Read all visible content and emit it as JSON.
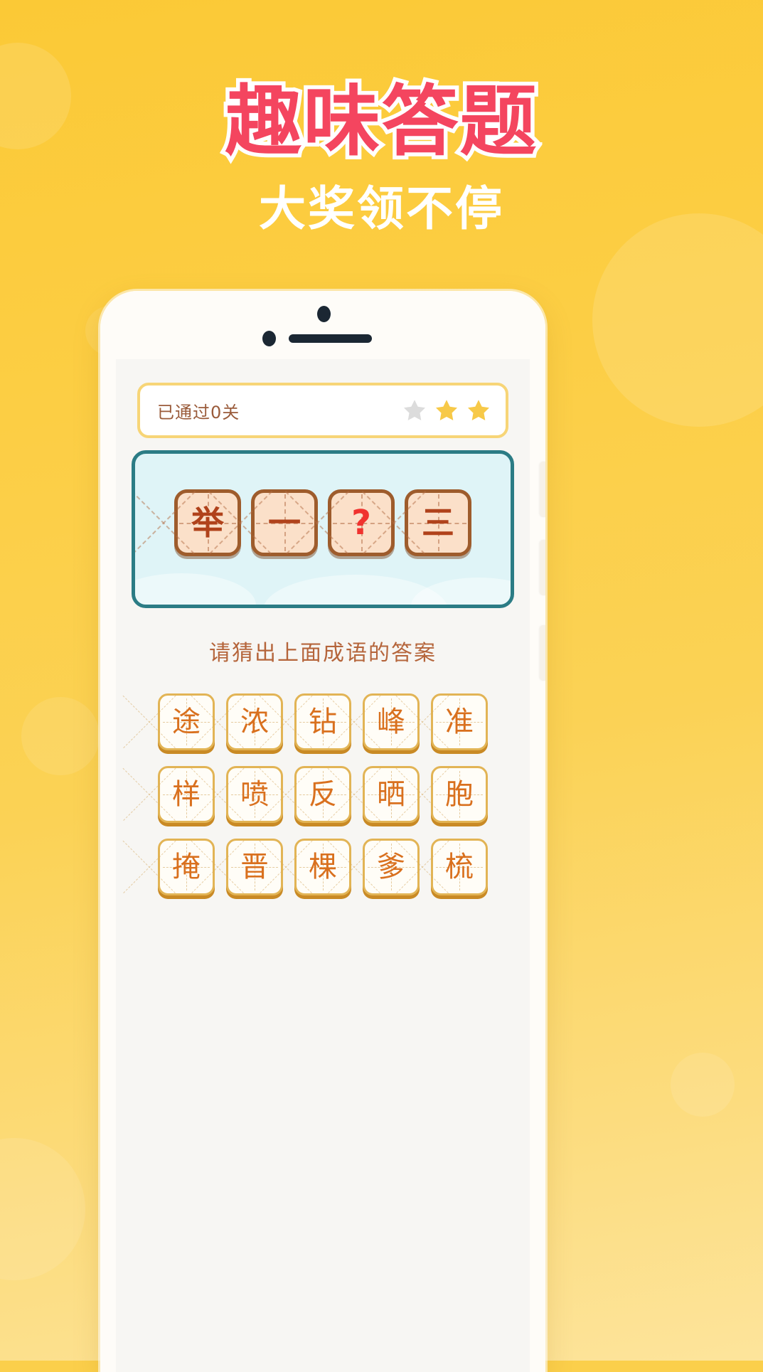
{
  "headline": {
    "main_title": "趣味答题",
    "subtitle": "大奖领不停",
    "title_color": "#F4455F",
    "subtitle_color": "#FFFFFF",
    "background_color": "#FBCF4B"
  },
  "app": {
    "progress": {
      "label": "已通过0关",
      "levels_passed": 0,
      "label_color": "#9A5B3A",
      "border_color": "#F7D577",
      "stars": [
        {
          "state": "empty",
          "color": "#DCDCDC"
        },
        {
          "state": "filled",
          "color": "#F7C948"
        },
        {
          "state": "filled",
          "color": "#F7C948"
        }
      ]
    },
    "puzzle": {
      "panel_border_color": "#2B7C85",
      "panel_bg_color": "#DFF4F7",
      "tiles": [
        {
          "char": "举",
          "state": "revealed"
        },
        {
          "char": "一",
          "state": "revealed"
        },
        {
          "char": "?",
          "state": "unknown"
        },
        {
          "char": "三",
          "state": "revealed"
        }
      ],
      "tile_fill_color": "#FBE0C9",
      "tile_border_color": "#9E5C2C",
      "tile_text_color": "#B0421B",
      "unknown_color": "#F0332F"
    },
    "instruction": "请猜出上面成语的答案",
    "instruction_color": "#B5653B",
    "answer_bank": {
      "tile_border_color": "#E2B455",
      "tile_shadow_color": "#C98A25",
      "tile_text_color": "#D9701E",
      "rows": [
        [
          "途",
          "浓",
          "钻",
          "峰",
          "准"
        ],
        [
          "样",
          "喷",
          "反",
          "晒",
          "胞"
        ],
        [
          "掩",
          "晋",
          "棵",
          "爹",
          "梳"
        ]
      ]
    }
  }
}
